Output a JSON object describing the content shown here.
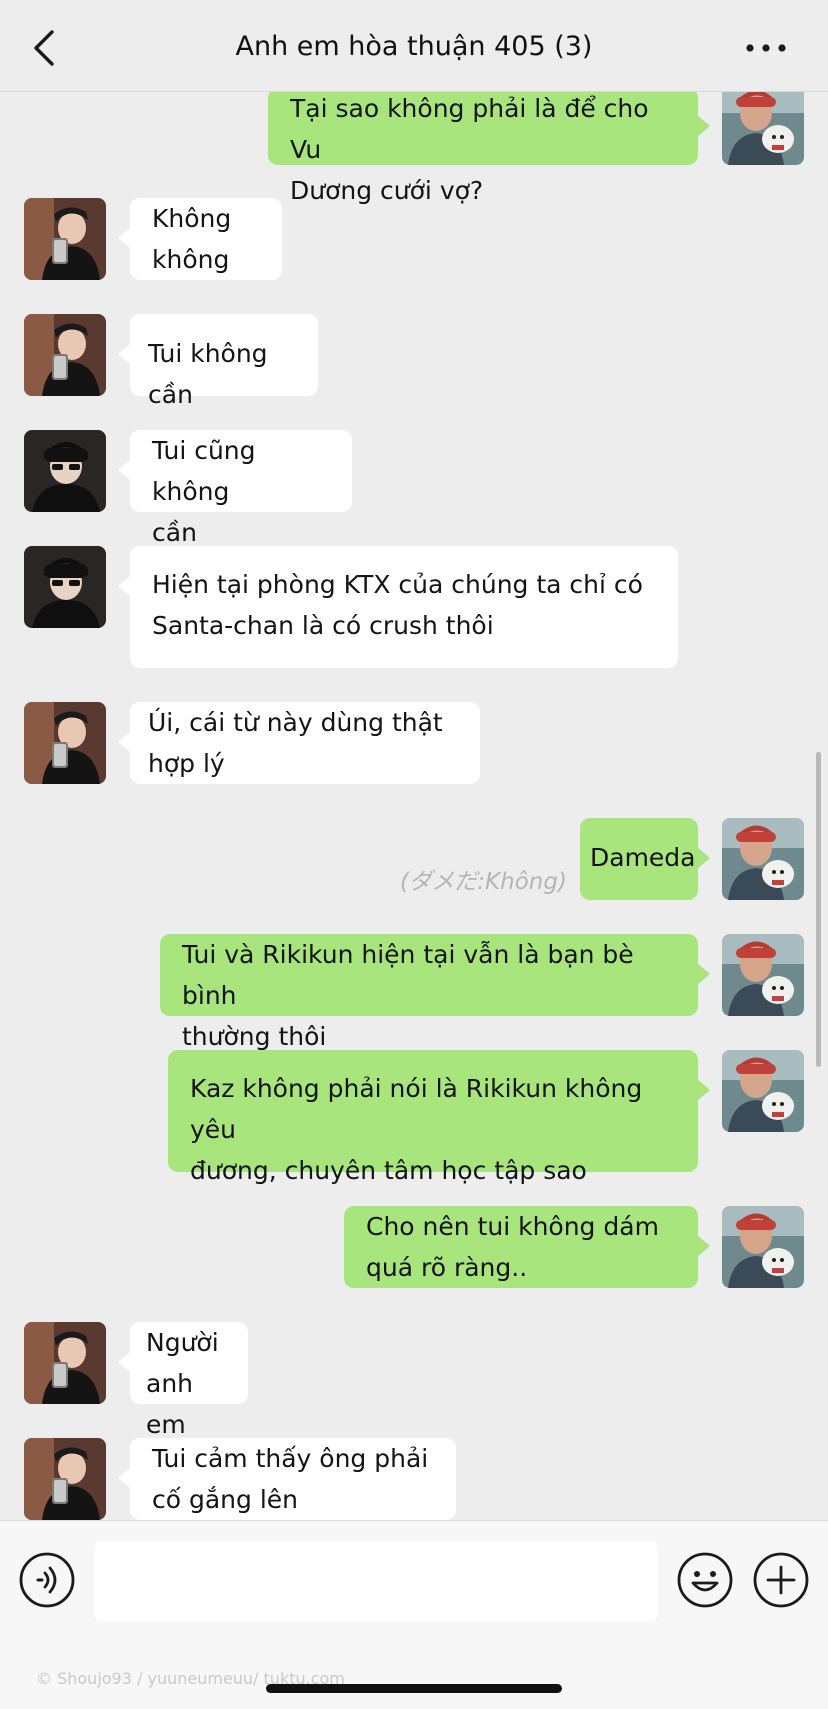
{
  "header": {
    "title": "Anh em hòa thuận 405 (3)",
    "back_icon": "chevron-left-icon",
    "more_icon": "more-dots-icon"
  },
  "messages": [
    {
      "side": "out",
      "sender": "self",
      "text": "Tại sao không phải là để cho Vu\nDương cưới vợ?"
    },
    {
      "side": "in",
      "sender": "friend-a",
      "text": "Không\nkhông"
    },
    {
      "side": "in",
      "sender": "friend-a",
      "text": "Tui không cần"
    },
    {
      "side": "in",
      "sender": "friend-b",
      "text": "Tui cũng không\ncần"
    },
    {
      "side": "in",
      "sender": "friend-b",
      "text": "Hiện tại phòng KTX của chúng ta chỉ có\nSanta-chan là có crush thôi"
    },
    {
      "side": "in",
      "sender": "friend-a",
      "text": "Úi, cái từ này dùng thật\nhợp lý"
    },
    {
      "side": "out",
      "sender": "self",
      "text": "Dameda"
    },
    {
      "side": "out",
      "sender": "self",
      "text": "Tui và Rikikun hiện tại vẫn là bạn bè bình\nthường thôi"
    },
    {
      "side": "out",
      "sender": "self",
      "text": "Kaz không phải nói là Rikikun không yêu\nđương, chuyên tâm học tập sao"
    },
    {
      "side": "out",
      "sender": "self",
      "text": "Cho nên tui không dám\nquá rõ ràng.."
    },
    {
      "side": "in",
      "sender": "friend-a",
      "text": "Người\nanh em"
    },
    {
      "side": "in",
      "sender": "friend-a",
      "text": "Tui cảm thấy ông phải\ncố gắng lên"
    }
  ],
  "translation_note": "(ダメだ:Không)",
  "input_bar": {
    "placeholder": "",
    "voice_icon": "voice-icon",
    "emoji_icon": "emoji-icon",
    "plus_icon": "plus-icon"
  },
  "watermark": "© Shoujo93 / yuuneumeuu/ tuktu.com",
  "colors": {
    "background": "#ededed",
    "outgoing_bubble": "#a8e57c",
    "incoming_bubble": "#ffffff"
  }
}
